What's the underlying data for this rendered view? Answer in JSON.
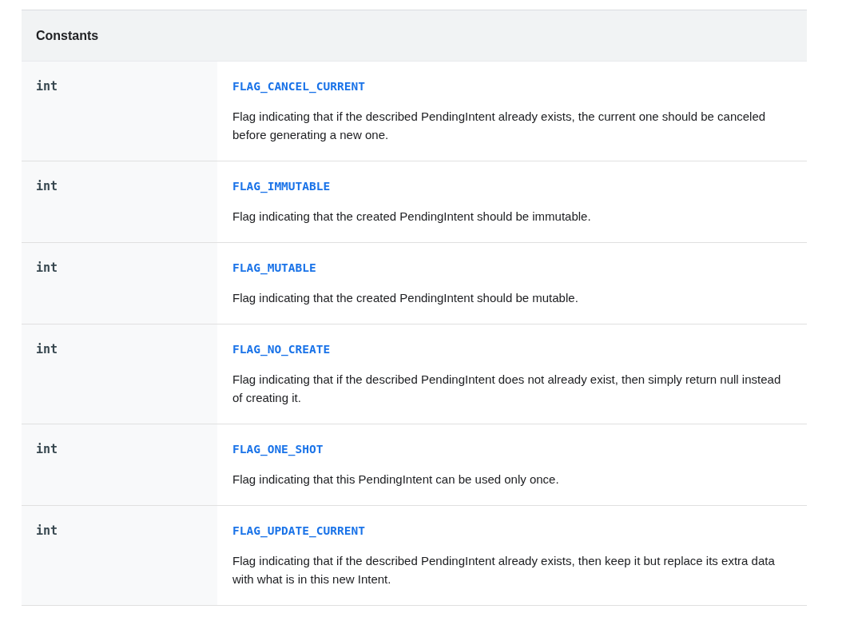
{
  "table": {
    "heading": "Constants",
    "rows": [
      {
        "type": "int",
        "name": "FLAG_CANCEL_CURRENT",
        "description": "Flag indicating that if the described PendingIntent already exists, the current one should be canceled before generating a new one."
      },
      {
        "type": "int",
        "name": "FLAG_IMMUTABLE",
        "description": "Flag indicating that the created PendingIntent should be immutable."
      },
      {
        "type": "int",
        "name": "FLAG_MUTABLE",
        "description": "Flag indicating that the created PendingIntent should be mutable."
      },
      {
        "type": "int",
        "name": "FLAG_NO_CREATE",
        "description": "Flag indicating that if the described PendingIntent does not already exist, then simply return null instead of creating it."
      },
      {
        "type": "int",
        "name": "FLAG_ONE_SHOT",
        "description": "Flag indicating that this PendingIntent can be used only once."
      },
      {
        "type": "int",
        "name": "FLAG_UPDATE_CURRENT",
        "description": "Flag indicating that if the described PendingIntent already exists, then keep it but replace its extra data with what is in this new Intent."
      }
    ]
  }
}
